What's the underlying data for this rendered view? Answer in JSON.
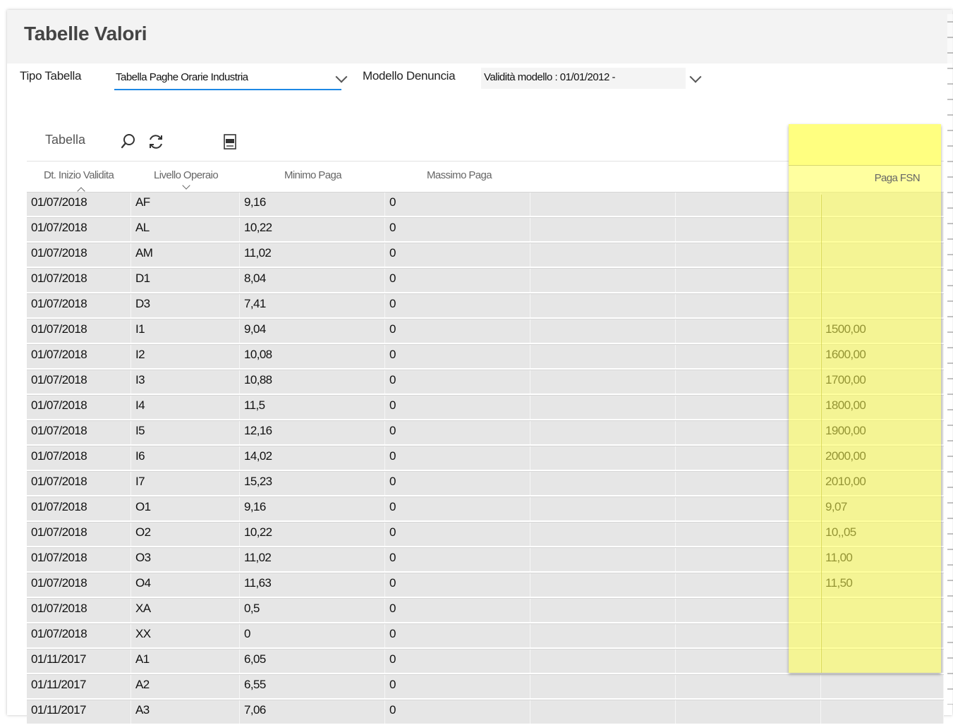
{
  "page": {
    "title": "Tabelle Valori"
  },
  "filters": {
    "tipo_label": "Tipo Tabella",
    "tipo_value": "Tabella Paghe Orarie Industria",
    "modello_label": "Modello Denuncia",
    "modello_value": "Validità modello : 01/01/2012 -"
  },
  "toolbar": {
    "label": "Tabella",
    "icons": [
      "search-icon",
      "refresh-icon",
      "csv-export-icon"
    ]
  },
  "table": {
    "columns": [
      "Dt. Inizio Validita",
      "Livello Operaio",
      "Minimo Paga",
      "Massimo Paga",
      "",
      "",
      "Paga FSN"
    ],
    "rows": [
      [
        "01/07/2018",
        "AF",
        "9,16",
        "0",
        ""
      ],
      [
        "01/07/2018",
        "AL",
        "10,22",
        "0",
        ""
      ],
      [
        "01/07/2018",
        "AM",
        "11,02",
        "0",
        ""
      ],
      [
        "01/07/2018",
        "D1",
        "8,04",
        "0",
        ""
      ],
      [
        "01/07/2018",
        "D3",
        "7,41",
        "0",
        ""
      ],
      [
        "01/07/2018",
        "I1",
        "9,04",
        "0",
        "1500,00"
      ],
      [
        "01/07/2018",
        "I2",
        "10,08",
        "0",
        "1600,00"
      ],
      [
        "01/07/2018",
        "I3",
        "10,88",
        "0",
        "1700,00"
      ],
      [
        "01/07/2018",
        "I4",
        "11,5",
        "0",
        "1800,00"
      ],
      [
        "01/07/2018",
        "I5",
        "12,16",
        "0",
        "1900,00"
      ],
      [
        "01/07/2018",
        "I6",
        "14,02",
        "0",
        "2000,00"
      ],
      [
        "01/07/2018",
        "I7",
        "15,23",
        "0",
        "2010,00"
      ],
      [
        "01/07/2018",
        "O1",
        "9,16",
        "0",
        "9,07"
      ],
      [
        "01/07/2018",
        "O2",
        "10,22",
        "0",
        "10,,05"
      ],
      [
        "01/07/2018",
        "O3",
        "11,02",
        "0",
        "11,00"
      ],
      [
        "01/07/2018",
        "O4",
        "11,63",
        "0",
        "11,50"
      ],
      [
        "01/07/2018",
        "XA",
        "0,5",
        "0",
        ""
      ],
      [
        "01/07/2018",
        "XX",
        "0",
        "0",
        ""
      ],
      [
        "01/11/2017",
        "A1",
        "6,05",
        "0",
        ""
      ],
      [
        "01/11/2017",
        "A2",
        "6,55",
        "0",
        ""
      ],
      [
        "01/11/2017",
        "A3",
        "7,06",
        "0",
        ""
      ]
    ]
  },
  "colors": {
    "accent": "#1e88e5",
    "highlight": "#ffff66",
    "row_bg": "#e6e6e6"
  }
}
